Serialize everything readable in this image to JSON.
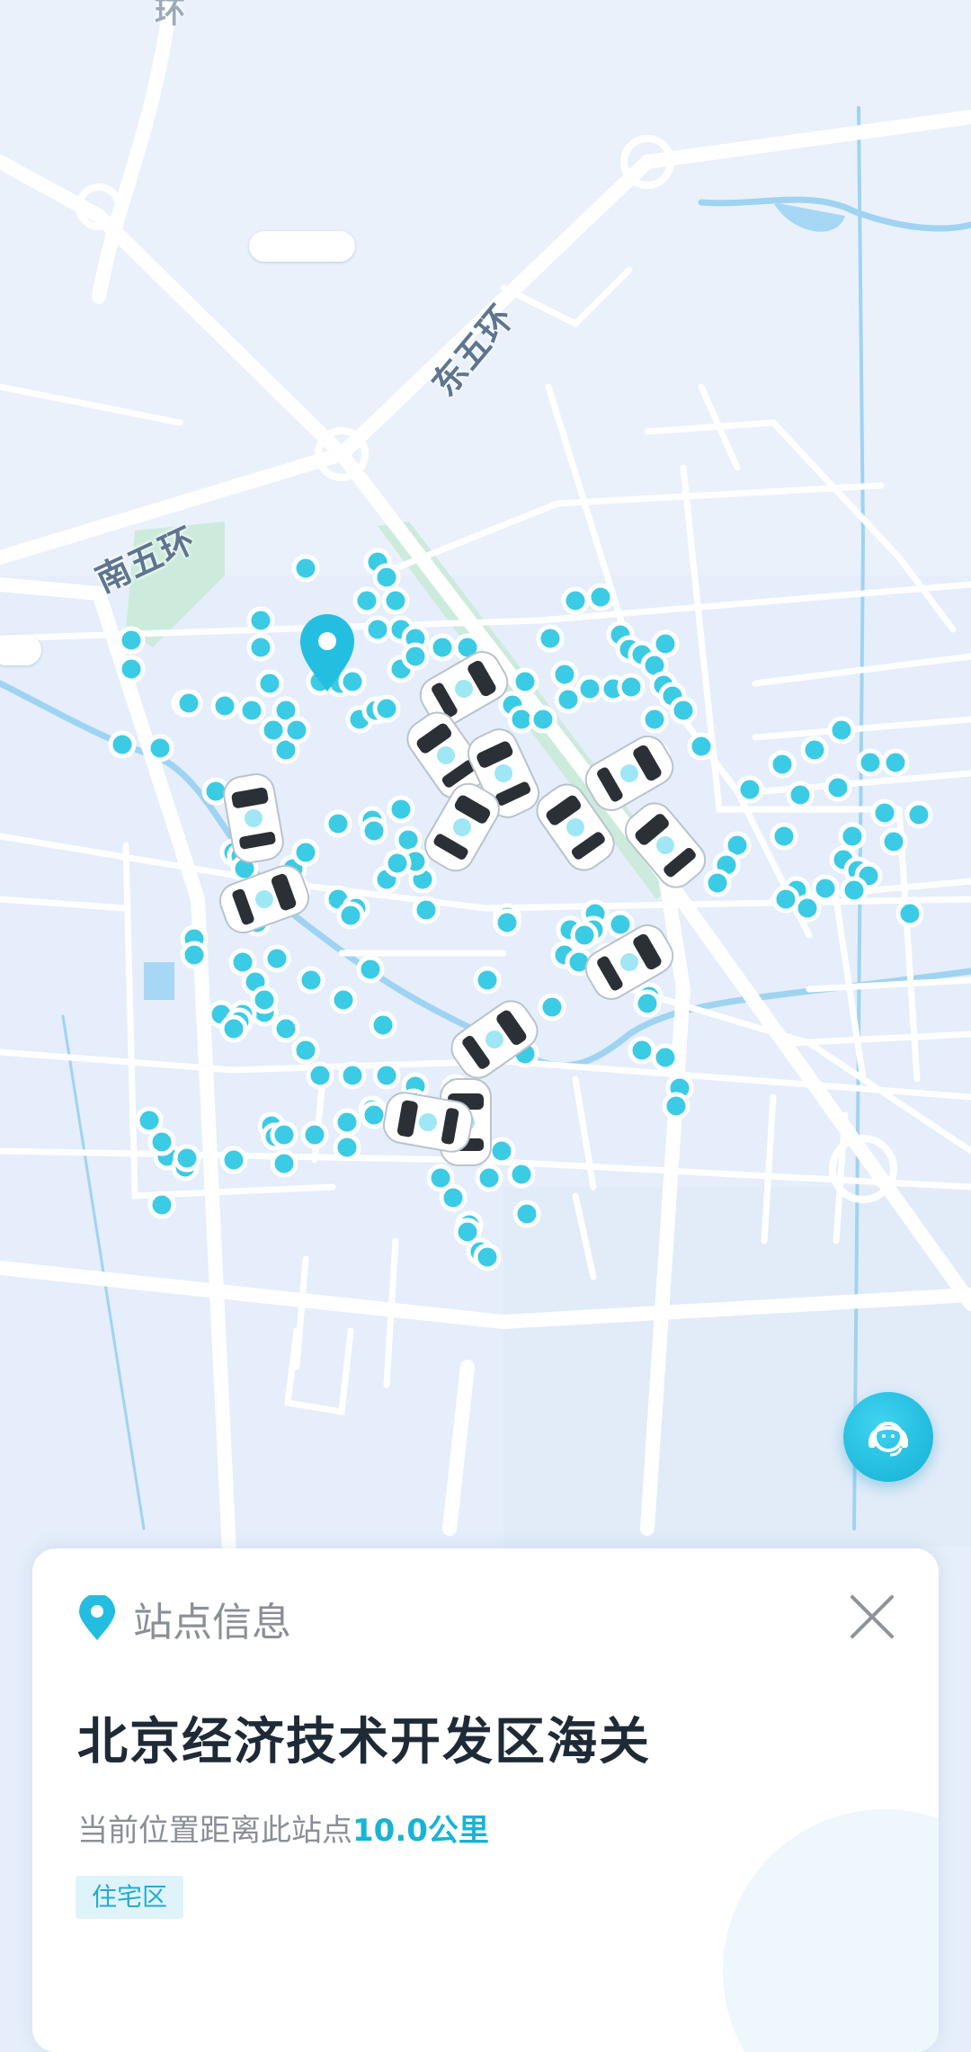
{
  "map": {
    "road_labels": [
      "南五环",
      "东五环",
      "环"
    ],
    "colors": {
      "station_dot": "#3ccbe4",
      "road": "#ffffff",
      "water": "#a6d8f5",
      "park": "#cdebdc"
    },
    "icons": {
      "selected_pin": "location-pin-icon",
      "vehicle": "robotaxi-icon",
      "support": "customer-service-icon"
    }
  },
  "station_card": {
    "header_title": "站点信息",
    "station_name": "北京经济技术开发区海关",
    "distance_prefix": "当前位置距离此站点",
    "distance_value": "10.0公里",
    "tag": "住宅区"
  }
}
